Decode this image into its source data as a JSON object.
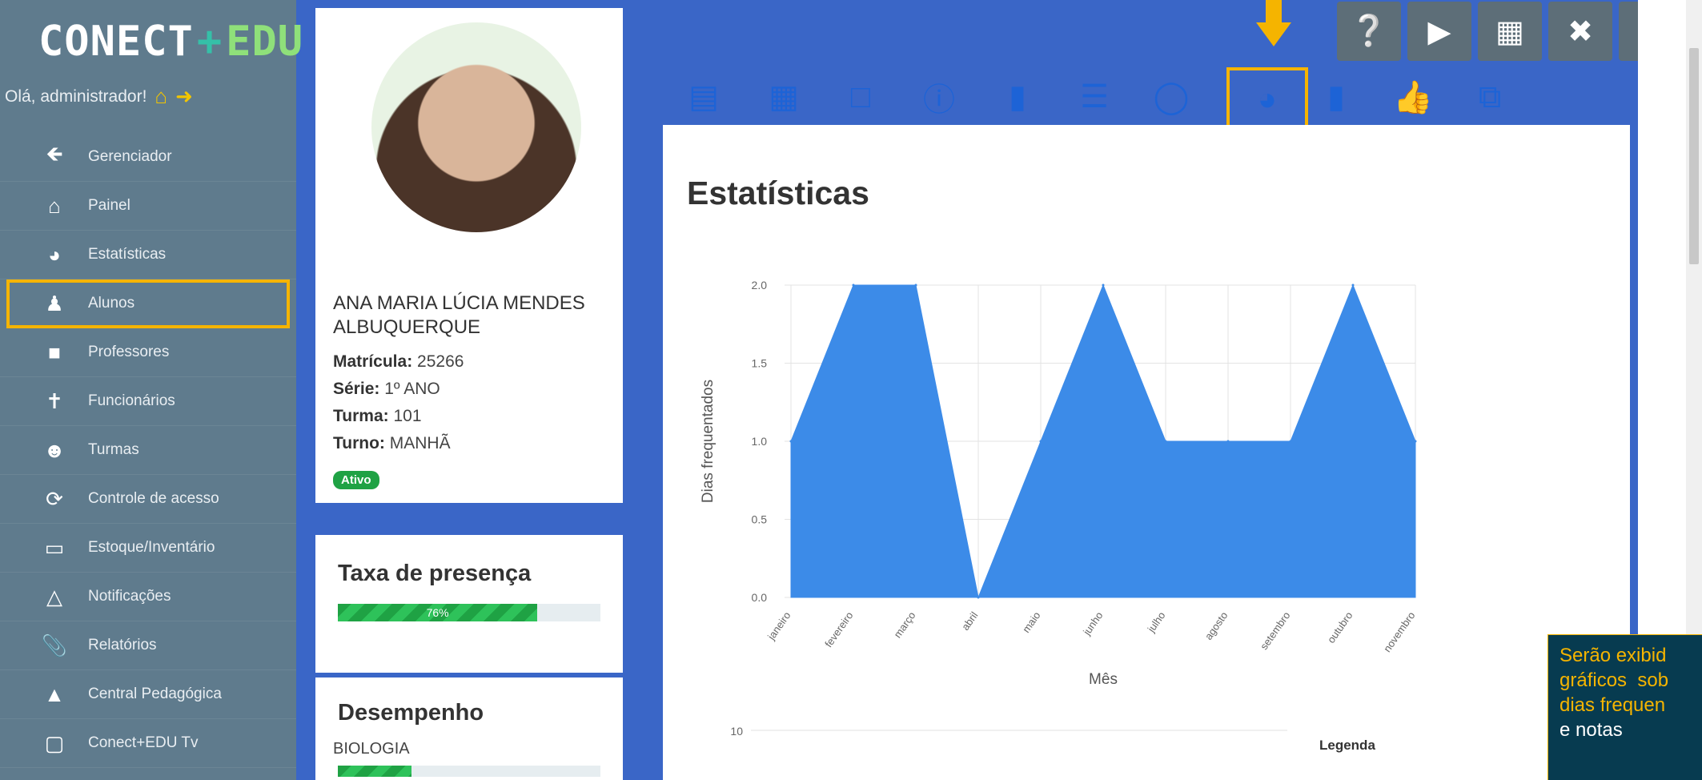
{
  "brand": {
    "conect": "CONECT",
    "plus": "+",
    "edu": "EDU"
  },
  "greeting": "Olá, administrador!",
  "sidebar": {
    "items": [
      {
        "label": "Gerenciador",
        "icon": "arrow-left-icon"
      },
      {
        "label": "Painel",
        "icon": "home-icon"
      },
      {
        "label": "Estatísticas",
        "icon": "pie-chart-icon"
      },
      {
        "label": "Alunos",
        "icon": "user-icon",
        "active": true
      },
      {
        "label": "Professores",
        "icon": "book-icon"
      },
      {
        "label": "Funcionários",
        "icon": "person-icon"
      },
      {
        "label": "Turmas",
        "icon": "group-icon"
      },
      {
        "label": "Controle de acesso",
        "icon": "refresh-icon"
      },
      {
        "label": "Estoque/Inventário",
        "icon": "laptop-icon"
      },
      {
        "label": "Notificações",
        "icon": "bell-icon"
      },
      {
        "label": "Relatórios",
        "icon": "paperclip-icon"
      },
      {
        "label": "Central Pedagógica",
        "icon": "graduation-cap-icon"
      },
      {
        "label": "Conect+EDU Tv",
        "icon": "monitor-icon"
      }
    ]
  },
  "student": {
    "name": "ANA MARIA LÚCIA MENDES ALBUQUERQUE",
    "matricula_label": "Matrícula:",
    "matricula": "25266",
    "serie_label": "Série:",
    "serie": "1º ANO",
    "turma_label": "Turma:",
    "turma": "101",
    "turno_label": "Turno:",
    "turno": "MANHÃ",
    "status": "Ativo"
  },
  "presence": {
    "title": "Taxa de presença",
    "value_label": "76%",
    "fraction": 0.76
  },
  "performance": {
    "title": "Desempenho",
    "subject": "BIOLOGIA",
    "fraction": 0.28
  },
  "toolbar_icons": [
    "id-card-icon",
    "calendar-icon",
    "note-icon",
    "help-circle-icon",
    "book-icon",
    "list-icon",
    "comment-icon",
    "pie-chart-icon",
    "book-icon",
    "thumbs-up-icon",
    "copy-icon"
  ],
  "toolbar_selected": 7,
  "top_buttons": [
    "help-icon",
    "megaphone-icon",
    "books-icon",
    "user-remove-icon",
    "warning-icon"
  ],
  "panel_title": "Estatísticas",
  "chart_data": [
    {
      "type": "area",
      "x": [
        "janeiro",
        "fevereiro",
        "março",
        "abril",
        "maio",
        "junho",
        "julho",
        "agosto",
        "setembro",
        "outubro",
        "novembro"
      ],
      "series": [
        {
          "values": [
            1,
            2,
            2,
            0,
            1,
            2,
            1,
            1,
            1,
            2,
            1
          ]
        }
      ],
      "xlabel": "Mês",
      "ylabel": "Dias frequentados",
      "yticks": [
        "0.0",
        "0.5",
        "1.0",
        "1.5",
        "2.0"
      ],
      "ylim": [
        0,
        2
      ],
      "grid": true,
      "color": "#3c8be8"
    },
    {
      "type": "chart",
      "ytick_top": "10",
      "legend_title": "Legenda"
    }
  ],
  "callout": {
    "line1": "Serão exibid",
    "line2": "gráficos  sob",
    "line3": "dias frequen",
    "line4": "e notas"
  },
  "colors": {
    "accent": "#f5b400",
    "sidebar": "#5f7b8d",
    "background": "#3a66c7",
    "chart": "#3c8be8"
  }
}
